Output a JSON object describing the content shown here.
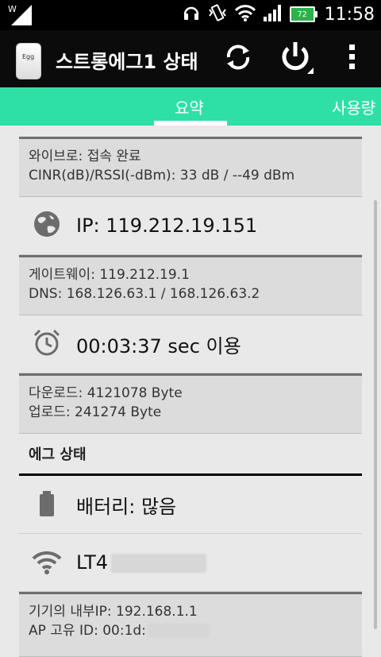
{
  "statusbar": {
    "time": "11:58",
    "battery_level": "72",
    "icons": [
      "signal-w-icon",
      "headset-icon",
      "vibrate-icon",
      "wifi-icon",
      "cell-signal-icon",
      "battery-icon"
    ]
  },
  "actionbar": {
    "app_icon_text": "Egg",
    "title": "스트롱에그1 상태",
    "refresh_icon": "refresh-icon",
    "power_icon": "power-icon",
    "overflow_icon": "overflow-menu-icon"
  },
  "tabs": {
    "summary": "요약",
    "usage": "사용량"
  },
  "wibro": {
    "status": "와이브로: 접속 완료",
    "signal": "CINR(dB)/RSSI(-dBm): 33 dB / --49 dBm"
  },
  "ip_row": {
    "icon": "globe-icon",
    "label": "IP: 119.212.19.151"
  },
  "network": {
    "gateway": "게이트웨이: 119.212.19.1",
    "dns": "DNS: 168.126.63.1 / 168.126.63.2"
  },
  "time_row": {
    "icon": "alarm-clock-icon",
    "label": "00:03:37 sec 이용"
  },
  "transfer": {
    "download": "다운로드: 4121078 Byte",
    "upload": "업로드: 241274 Byte"
  },
  "egg_status_header": "에그 상태",
  "battery_row": {
    "icon": "battery-icon",
    "label": "배터리: 많음"
  },
  "wifi_row": {
    "icon": "wifi-icon",
    "label": "LT4"
  },
  "device": {
    "internal_ip": "기기의 내부IP: 192.168.1.1",
    "ap_id": "AP 고유 ID: 00:1d:"
  },
  "colors": {
    "accent": "#2fe0a6",
    "actionbar": "#0b0b0b",
    "background": "#e9e9e9"
  }
}
